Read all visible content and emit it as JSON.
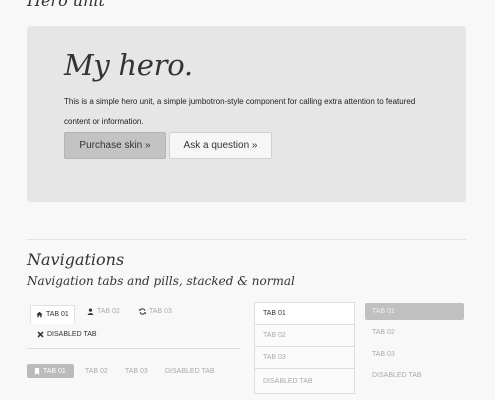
{
  "hero_section": {
    "title": "Hero unit"
  },
  "hero": {
    "title": "My hero.",
    "description": "This is a simple hero unit, a simple jumbotron-style component for calling extra attention to featured content or information.",
    "primary_button": "Purchase skin »",
    "secondary_button": "Ask a question »"
  },
  "navigation": {
    "title": "Navigations",
    "subtitle": "Navigation tabs and pills, stacked & normal"
  },
  "tabs": [
    {
      "label": "TAB 01",
      "icon": "home-icon",
      "active": true
    },
    {
      "label": "TAB 02",
      "icon": "user-icon",
      "active": false
    },
    {
      "label": "TAB 03",
      "icon": "refresh-icon",
      "active": false
    },
    {
      "label": "DISABLED TAB",
      "icon": "close-icon",
      "active": false
    }
  ],
  "pills": [
    {
      "label": "TAB 01",
      "icon": "bookmark-icon",
      "active": true
    },
    {
      "label": "TAB 02",
      "active": false
    },
    {
      "label": "TAB 03",
      "active": false
    },
    {
      "label": "DISABLED TAB",
      "active": false
    }
  ],
  "stacked_tabs": [
    {
      "label": "TAB 01",
      "active": true
    },
    {
      "label": "TAB 02",
      "active": false
    },
    {
      "label": "TAB 03",
      "active": false
    },
    {
      "label": "DISABLED TAB",
      "active": false
    }
  ],
  "stacked_pills": [
    {
      "label": "TAB 01",
      "active": true
    },
    {
      "label": "TAB 02",
      "active": false
    },
    {
      "label": "TAB 03",
      "active": false
    },
    {
      "label": "DISABLED TAB",
      "active": false
    }
  ],
  "colors": {
    "page_background": "#f8f8f8",
    "hero_background": "#e6e6e6",
    "active_pill": "#bbbbbb",
    "primary_button": "#c3c3c3"
  }
}
